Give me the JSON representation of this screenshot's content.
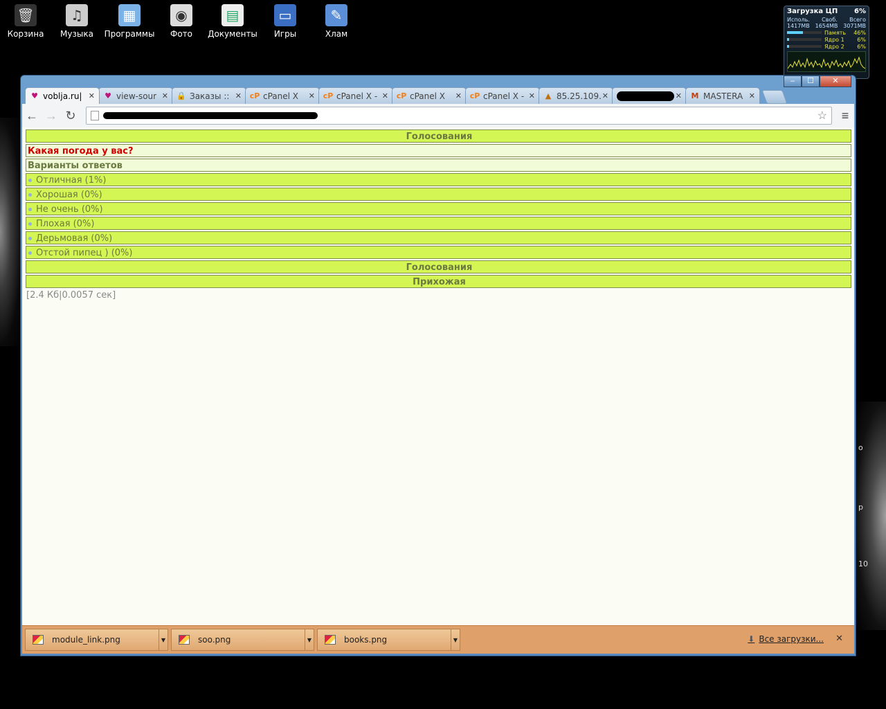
{
  "desktop": {
    "icons": [
      {
        "label": "Корзина",
        "icon": "recycle-bin-icon"
      },
      {
        "label": "Музыка",
        "icon": "music-icon"
      },
      {
        "label": "Программы",
        "icon": "programs-icon"
      },
      {
        "label": "Фото",
        "icon": "camera-icon"
      },
      {
        "label": "Документы",
        "icon": "documents-icon"
      },
      {
        "label": "Игры",
        "icon": "games-icon"
      },
      {
        "label": "Хлам",
        "icon": "junk-icon"
      }
    ],
    "right_text": [
      "o",
      "p",
      "10"
    ]
  },
  "gadget": {
    "title": "Загрузка ЦП",
    "cpu_value": "6%",
    "head_labels": [
      "Исполь.",
      "Своб.",
      "Всего"
    ],
    "head_values": [
      "1417MB",
      "1654MB",
      "3071MB"
    ],
    "rows": [
      {
        "label": "Память",
        "value": "46%",
        "fraction": 0.46
      },
      {
        "label": "Ядро 1",
        "value": "6%",
        "fraction": 0.06
      },
      {
        "label": "Ядро 2",
        "value": "6%",
        "fraction": 0.06
      }
    ]
  },
  "browser": {
    "controls": {
      "min": "–",
      "max": "☐",
      "close": "✕"
    },
    "tabs": [
      {
        "title": "voblja.ru|",
        "icon": "heart-icon",
        "active": true
      },
      {
        "title": "view-sour",
        "icon": "heart-icon"
      },
      {
        "title": "Заказы ::",
        "icon": "lock-icon"
      },
      {
        "title": "cPanel X",
        "icon": "cpanel-icon"
      },
      {
        "title": "cPanel X -",
        "icon": "cpanel-icon"
      },
      {
        "title": "cPanel X",
        "icon": "cpanel-icon"
      },
      {
        "title": "cPanel X -",
        "icon": "cpanel-icon"
      },
      {
        "title": "85.25.109.",
        "icon": "phpmyadmin-icon"
      },
      {
        "title": "",
        "icon": "",
        "redacted": true
      },
      {
        "title": "MASTERA",
        "icon": "m-icon"
      }
    ],
    "tab_close": "✕",
    "nav": {
      "back": "←",
      "forward": "→",
      "reload": "↻",
      "star": "☆",
      "menu": "≡"
    }
  },
  "page": {
    "poll_header": "Голосования",
    "question": "Какая погода у вас?",
    "answers_title": "Варианты ответов",
    "options": [
      "Отличная (1%)",
      "Хорошая (0%)",
      "Не очень (0%)",
      "Плохая (0%)",
      "Дерьмовая (0%)",
      "Отстой пипец ) (0%)"
    ],
    "poll_footer": "Голосования",
    "hall": "Прихожая",
    "stats": "[2.4 Кб|0.0057 сек]"
  },
  "downloads": {
    "items": [
      "module_link.png",
      "soo.png",
      "books.png"
    ],
    "all_label": "Все загрузки...",
    "close": "✕"
  }
}
